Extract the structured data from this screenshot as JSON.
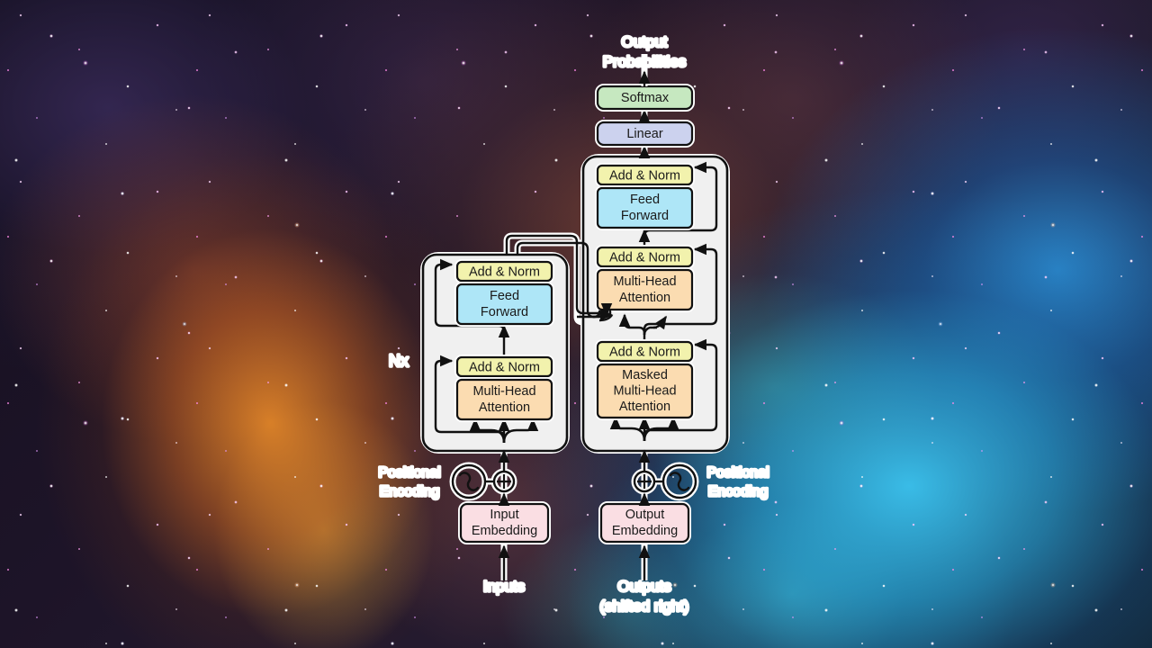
{
  "figure": {
    "title": "Transformer model architecture",
    "background": "galaxy-nebula-starfield"
  },
  "colors": {
    "add_norm": "#f2f2ad",
    "feed_forward": "#aee6f7",
    "attention": "#fbdcb1",
    "embedding": "#fadee3",
    "linear": "#ccd2ee",
    "softmax": "#c6e8c0",
    "panel": "#efefef",
    "stroke": "#111111",
    "halo": "#ffffff"
  },
  "labels": {
    "output_probabilities_line1": "Output",
    "output_probabilities_line2": "Probabilities",
    "softmax": "Softmax",
    "linear": "Linear",
    "add_norm": "Add & Norm",
    "feed_forward_line1": "Feed",
    "feed_forward_line2": "Forward",
    "multi_head_line1": "Multi-Head",
    "multi_head_line2": "Attention",
    "masked_line1": "Masked",
    "masked_line2": "Multi-Head",
    "masked_line3": "Attention",
    "nx": "Nx",
    "positional_line1": "Positional",
    "positional_line2": "Encoding",
    "input_embedding_line1": "Input",
    "input_embedding_line2": "Embedding",
    "output_embedding_line1": "Output",
    "output_embedding_line2": "Embedding",
    "inputs": "Inputs",
    "outputs_line1": "Outputs",
    "outputs_line2": "(shifted right)"
  },
  "encoder": {
    "stack_label": "Nx",
    "blocks": [
      {
        "name": "add-norm-top",
        "label": "Add & Norm",
        "color": "#f2f2ad"
      },
      {
        "name": "feed-forward",
        "label": "Feed Forward",
        "color": "#aee6f7"
      },
      {
        "name": "add-norm-bottom",
        "label": "Add & Norm",
        "color": "#f2f2ad"
      },
      {
        "name": "multi-head-attention",
        "label": "Multi-Head Attention",
        "color": "#fbdcb1"
      }
    ],
    "input_path": [
      "Inputs",
      "Input Embedding",
      "Positional Encoding"
    ]
  },
  "decoder": {
    "blocks": [
      {
        "name": "add-norm-top",
        "label": "Add & Norm",
        "color": "#f2f2ad"
      },
      {
        "name": "feed-forward",
        "label": "Feed Forward",
        "color": "#aee6f7"
      },
      {
        "name": "add-norm-middle",
        "label": "Add & Norm",
        "color": "#f2f2ad"
      },
      {
        "name": "multi-head-attention",
        "label": "Multi-Head Attention",
        "color": "#fbdcb1"
      },
      {
        "name": "add-norm-bottom",
        "label": "Add & Norm",
        "color": "#f2f2ad"
      },
      {
        "name": "masked-multi-head-attention",
        "label": "Masked Multi-Head Attention",
        "color": "#fbdcb1"
      }
    ],
    "input_path": [
      "Outputs (shifted right)",
      "Output Embedding",
      "Positional Encoding"
    ],
    "output_path": [
      "Linear",
      "Softmax",
      "Output Probabilities"
    ]
  },
  "icons": {
    "positional_encoding_icon": "sine-wave-circle-icon",
    "add_node_icon": "plus-circle-icon",
    "arrow_icon": "arrow-up-icon"
  }
}
